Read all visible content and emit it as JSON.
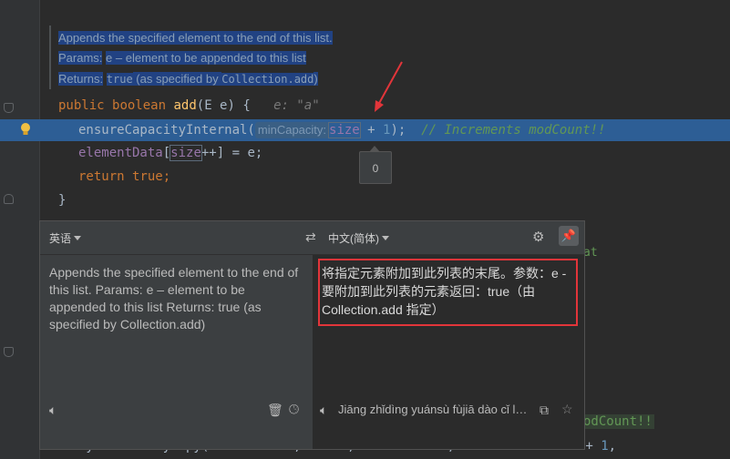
{
  "doc": {
    "line1": "Appends the specified element to the end of this list.",
    "params_label": "Params:",
    "params_value": "e – element to be appended to this list",
    "returns_label": "Returns:",
    "returns_true": "true",
    "returns_rest": " (as specified by ",
    "returns_code": "Collection.add",
    "returns_end": ")"
  },
  "code": {
    "public": "public",
    "boolean": "boolean",
    "method": "add",
    "signature": "(E e) {",
    "hint_e": "e: \"a\"",
    "ensure": "ensureCapacityInternal(",
    "inlay_min": "minCapacity:",
    "size": "size",
    "plus_one_pre": " + ",
    "one": "1",
    "close": ");",
    "comment": "// Increments modCount!!",
    "elementData": "elementData",
    "size2": "size",
    "plusplus": "++",
    "assign": "] = e;",
    "return_kw": "return",
    "true_kw": "true",
    "semi": ";",
    "brace": "}",
    "tooltip_value": "0",
    "right_fragment": "at"
  },
  "translator": {
    "source_lang": "英语",
    "target_lang": "中文(简体)",
    "source_text": "Appends the specified element to the end of this list. Params: e – element to be appended to this list Returns: true (as specified by Collection.add)",
    "translated_text": "将指定元素附加到此列表的末尾。参数：e - 要附加到此列表的元素返回：true（由 Collection.add 指定）",
    "transliteration": "Jiāng zhǐdìng yuánsù fùjiā dào cǐ liè..."
  },
  "bottom": {
    "comment_frag": "odCount!!",
    "line": "System.arraycopy(elementData, index, elementData,",
    "hint": "destPos:",
    "tail_index": "index + ",
    "tail_one": "1",
    "tail_comma": ","
  }
}
